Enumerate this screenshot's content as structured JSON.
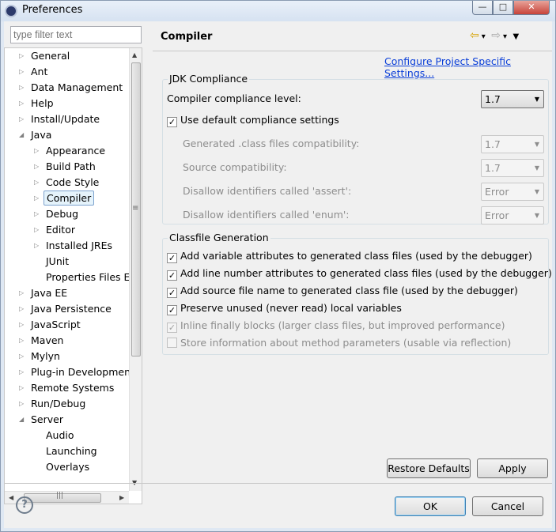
{
  "window": {
    "title": "Preferences",
    "controls": {
      "minimize": "—",
      "maximize": "□",
      "close": "✕"
    }
  },
  "filter": {
    "placeholder": "type filter text"
  },
  "tree": [
    {
      "label": "General",
      "arrow": "▷",
      "level": 0
    },
    {
      "label": "Ant",
      "arrow": "▷",
      "level": 0
    },
    {
      "label": "Data Management",
      "arrow": "▷",
      "level": 0
    },
    {
      "label": "Help",
      "arrow": "▷",
      "level": 0
    },
    {
      "label": "Install/Update",
      "arrow": "▷",
      "level": 0
    },
    {
      "label": "Java",
      "arrow": "◢",
      "level": 0
    },
    {
      "label": "Appearance",
      "arrow": "▷",
      "level": 1
    },
    {
      "label": "Build Path",
      "arrow": "▷",
      "level": 1
    },
    {
      "label": "Code Style",
      "arrow": "▷",
      "level": 1
    },
    {
      "label": "Compiler",
      "arrow": "▷",
      "level": 1,
      "selected": true
    },
    {
      "label": "Debug",
      "arrow": "▷",
      "level": 1
    },
    {
      "label": "Editor",
      "arrow": "▷",
      "level": 1
    },
    {
      "label": "Installed JREs",
      "arrow": "▷",
      "level": 1
    },
    {
      "label": "JUnit",
      "arrow": "",
      "level": 1
    },
    {
      "label": "Properties Files Ed",
      "arrow": "",
      "level": 1
    },
    {
      "label": "Java EE",
      "arrow": "▷",
      "level": 0
    },
    {
      "label": "Java Persistence",
      "arrow": "▷",
      "level": 0
    },
    {
      "label": "JavaScript",
      "arrow": "▷",
      "level": 0
    },
    {
      "label": "Maven",
      "arrow": "▷",
      "level": 0
    },
    {
      "label": "Mylyn",
      "arrow": "▷",
      "level": 0
    },
    {
      "label": "Plug-in Development",
      "arrow": "▷",
      "level": 0
    },
    {
      "label": "Remote Systems",
      "arrow": "▷",
      "level": 0
    },
    {
      "label": "Run/Debug",
      "arrow": "▷",
      "level": 0
    },
    {
      "label": "Server",
      "arrow": "◢",
      "level": 0
    },
    {
      "label": "Audio",
      "arrow": "",
      "level": 1
    },
    {
      "label": "Launching",
      "arrow": "",
      "level": 1
    },
    {
      "label": "Overlays",
      "arrow": "",
      "level": 1
    }
  ],
  "scroll": {
    "up": "▲",
    "down": "▼",
    "left": "◀",
    "right": "▶",
    "grip": "≡",
    "hgrip": "|||"
  },
  "page": {
    "title": "Compiler",
    "nav": {
      "back": "⇦",
      "back_menu": "▾",
      "forward": "⇨",
      "forward_menu": "▾",
      "view_menu": "▼"
    },
    "config_link": "Configure Project Specific Settings..."
  },
  "jdk": {
    "title": "JDK Compliance",
    "compliance_label": "Compiler compliance level:",
    "compliance_value": "1.7",
    "use_default_label": "Use default compliance settings",
    "use_default_checked": true,
    "settings": [
      {
        "label": "Generated .class files compatibility:",
        "value": "1.7"
      },
      {
        "label": "Source compatibility:",
        "value": "1.7"
      },
      {
        "label": "Disallow identifiers called 'assert':",
        "value": "Error"
      },
      {
        "label": "Disallow identifiers called 'enum':",
        "value": "Error"
      }
    ]
  },
  "classfile": {
    "title": "Classfile Generation",
    "options": [
      {
        "label": "Add variable attributes to generated class files (used by the debugger)",
        "checked": true,
        "enabled": true
      },
      {
        "label": "Add line number attributes to generated class files (used by the debugger)",
        "checked": true,
        "enabled": true
      },
      {
        "label": "Add source file name to generated class file (used by the debugger)",
        "checked": true,
        "enabled": true
      },
      {
        "label": "Preserve unused (never read) local variables",
        "checked": true,
        "enabled": true
      },
      {
        "label": "Inline finally blocks (larger class files, but improved performance)",
        "checked": true,
        "enabled": false
      },
      {
        "label": "Store information about method parameters (usable via reflection)",
        "checked": false,
        "enabled": false
      }
    ]
  },
  "buttons": {
    "restore": "Restore Defaults",
    "apply": "Apply",
    "ok": "OK",
    "cancel": "Cancel",
    "help": "?"
  },
  "checkmark": "✓",
  "dropdown_arrow": "▼"
}
